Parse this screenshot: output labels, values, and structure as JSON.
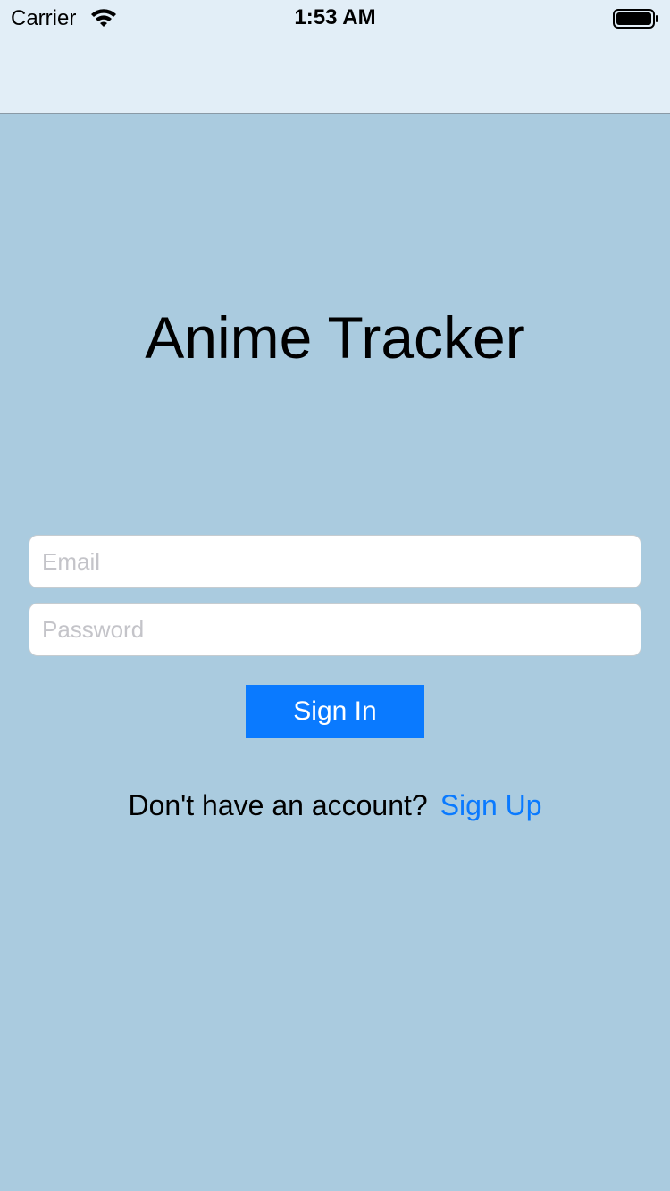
{
  "status_bar": {
    "carrier": "Carrier",
    "time": "1:53 AM",
    "icons": [
      "wifi-icon",
      "battery-icon"
    ]
  },
  "login": {
    "title": "Anime Tracker",
    "email_placeholder": "Email",
    "email_value": "",
    "password_placeholder": "Password",
    "password_value": "",
    "sign_in_label": "Sign In",
    "signup_prompt": "Don't have an account?",
    "signup_link": "Sign Up"
  },
  "colors": {
    "background": "#aacbdf",
    "nav_background": "#e2eef7",
    "accent": "#0a7aff"
  }
}
